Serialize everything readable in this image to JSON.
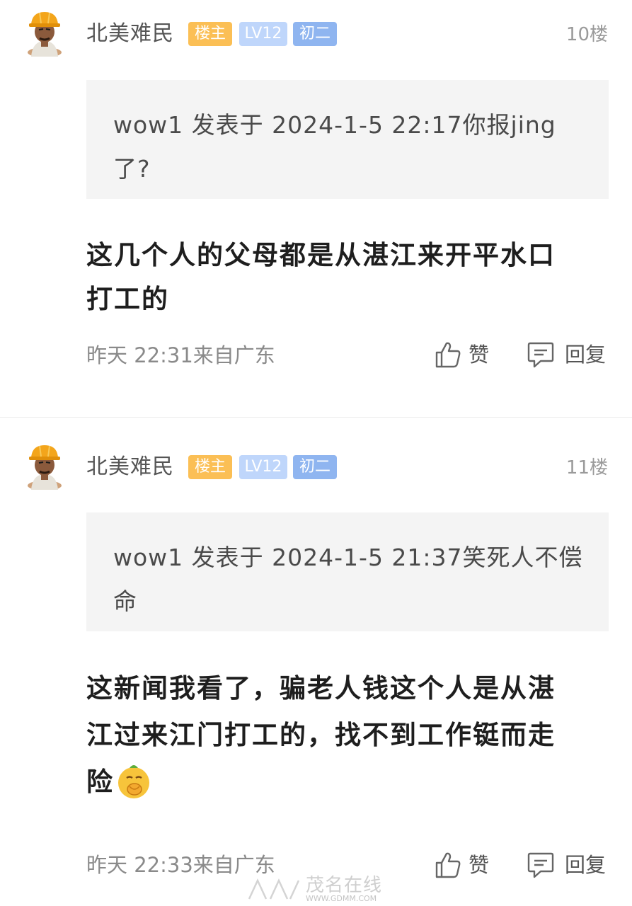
{
  "posts": [
    {
      "username": "北美难民",
      "badges": {
        "owner": "楼主",
        "level": "LV12",
        "rank": "初二"
      },
      "floor": "10楼",
      "quote": "wow1 发表于 2024-1-5 22:17你报jing了?",
      "content": "这几个人的父母都是从湛江来开平水口打工的",
      "meta": "昨天 22:31来自广东",
      "like_label": "赞",
      "reply_label": "回复"
    },
    {
      "username": "北美难民",
      "badges": {
        "owner": "楼主",
        "level": "LV12",
        "rank": "初二"
      },
      "floor": "11楼",
      "quote": "wow1 发表于 2024-1-5 21:37笑死人不偿命",
      "content": "这新闻我看了，骗老人钱这个人是从湛江过来江门打工的，找不到工作铤而走险",
      "meta": "昨天 22:33来自广东",
      "like_label": "赞",
      "reply_label": "回复"
    }
  ],
  "watermark": {
    "text": "茂名在线",
    "url": "WWW.GDMM.COM"
  },
  "colors": {
    "owner_badge": "#fbbf55",
    "level_badge": "#bfd6fb",
    "rank_badge": "#8fb5f0",
    "quote_bg": "#f4f4f4"
  },
  "icons": [
    "avatar-worker",
    "thumbs-up-icon",
    "comment-icon",
    "face-emoji-icon"
  ]
}
